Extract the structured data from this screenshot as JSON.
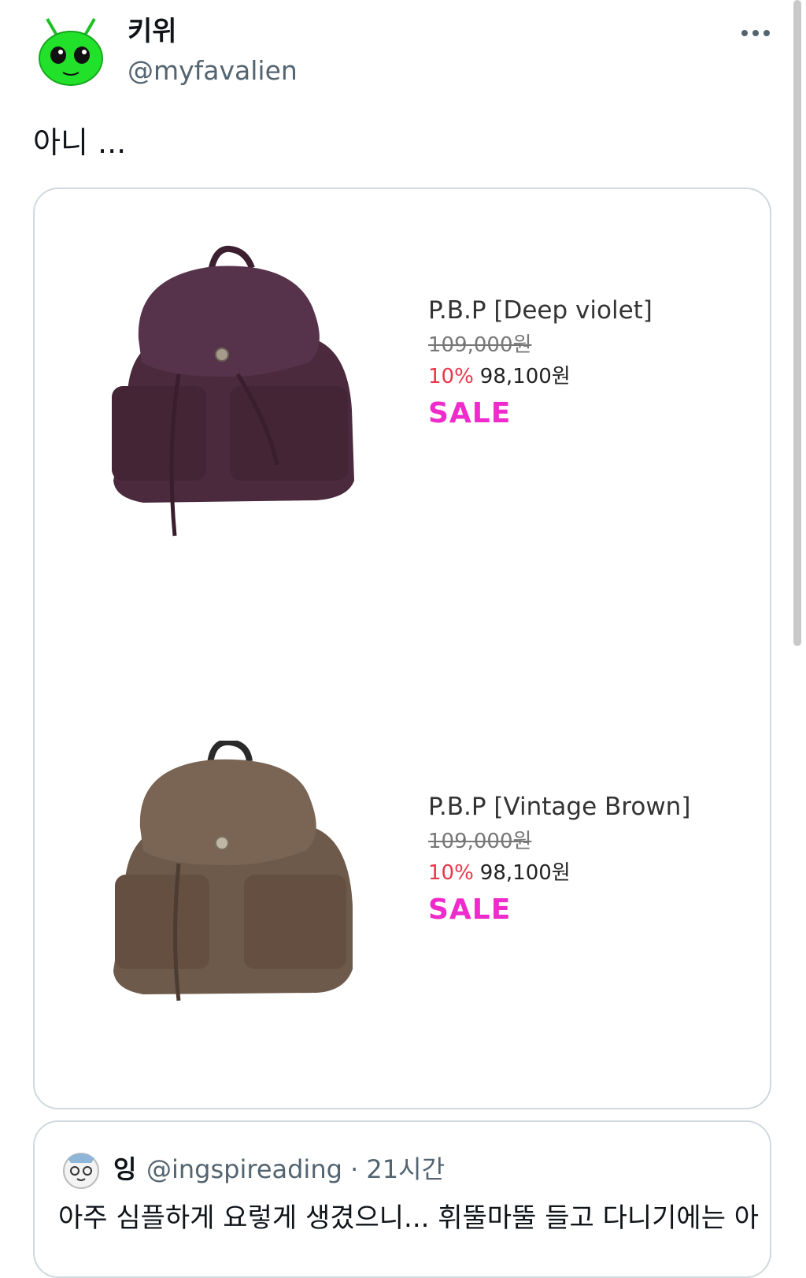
{
  "author": {
    "display_name": "키위",
    "handle": "@myfavalien"
  },
  "tweet": {
    "text": "아니 ..."
  },
  "products": [
    {
      "name": "P.B.P [Deep violet]",
      "original_price": "109,000원",
      "discount": "10%",
      "price": "98,100원",
      "badge": "SALE",
      "color": "#4a2a3c"
    },
    {
      "name": "P.B.P [Vintage Brown]",
      "original_price": "109,000원",
      "discount": "10%",
      "price": "98,100원",
      "badge": "SALE",
      "color": "#6e5a4b"
    }
  ],
  "quote": {
    "display_name": "잉",
    "handle": "@ingspireading",
    "time": "· 21시간",
    "text": "아주 심플하게 요렇게 생겼으니... 휘뚤마뚤 들고 다니기에는 아"
  },
  "colors": {
    "accent_sale": "#ef2bcb",
    "discount": "#e8364a",
    "muted": "#536471",
    "avatar_green": "#22e12b"
  }
}
